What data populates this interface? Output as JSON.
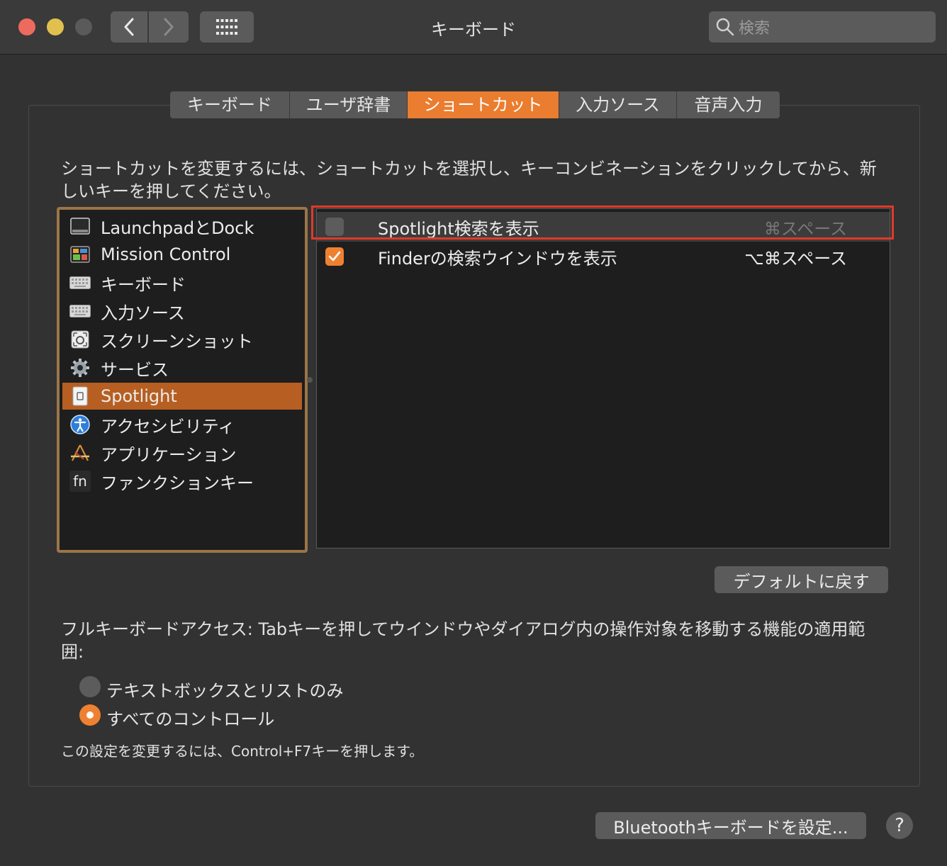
{
  "window": {
    "title": "キーボード",
    "search_placeholder": "検索"
  },
  "tabs": [
    {
      "label": "キーボード",
      "active": false
    },
    {
      "label": "ユーザ辞書",
      "active": false
    },
    {
      "label": "ショートカット",
      "active": true
    },
    {
      "label": "入力ソース",
      "active": false
    },
    {
      "label": "音声入力",
      "active": false
    }
  ],
  "instructions": "ショートカットを変更するには、ショートカットを選択し、キーコンビネーションをクリックしてから、新しいキーを押してください。",
  "categories": [
    {
      "label": "LaunchpadとDock",
      "icon": "launchpad-icon"
    },
    {
      "label": "Mission Control",
      "icon": "mission-control-icon"
    },
    {
      "label": "キーボード",
      "icon": "keyboard-icon"
    },
    {
      "label": "入力ソース",
      "icon": "keyboard-icon"
    },
    {
      "label": "スクリーンショット",
      "icon": "screenshot-icon"
    },
    {
      "label": "サービス",
      "icon": "gear-icon"
    },
    {
      "label": "Spotlight",
      "icon": "spotlight-icon",
      "selected": true
    },
    {
      "label": "アクセシビリティ",
      "icon": "accessibility-icon"
    },
    {
      "label": "アプリケーション",
      "icon": "app-store-icon"
    },
    {
      "label": "ファンクションキー",
      "icon": "fn-key-icon",
      "icon_text": "fn"
    }
  ],
  "shortcuts": [
    {
      "label": "Spotlight検索を表示",
      "key": "⌘スペース",
      "checked": false
    },
    {
      "label": "Finderの検索ウインドウを表示",
      "key": "⌥⌘スペース",
      "checked": true
    }
  ],
  "restore_defaults_label": "デフォルトに戻す",
  "full_keyboard_access": {
    "description": "フルキーボードアクセス: Tabキーを押してウインドウやダイアログ内の操作対象を移動する機能の適用範囲:",
    "options": [
      {
        "label": "テキストボックスとリストのみ",
        "selected": false
      },
      {
        "label": "すべてのコントロール",
        "selected": true
      }
    ],
    "note": "この設定を変更するには、Control+F7キーを押します。"
  },
  "bluetooth_button_label": "Bluetoothキーボードを設定...",
  "help_label": "?",
  "colors": {
    "accent": "#ea7d2f",
    "selection": "#b75f22",
    "highlight_border": "#e03a2a"
  }
}
